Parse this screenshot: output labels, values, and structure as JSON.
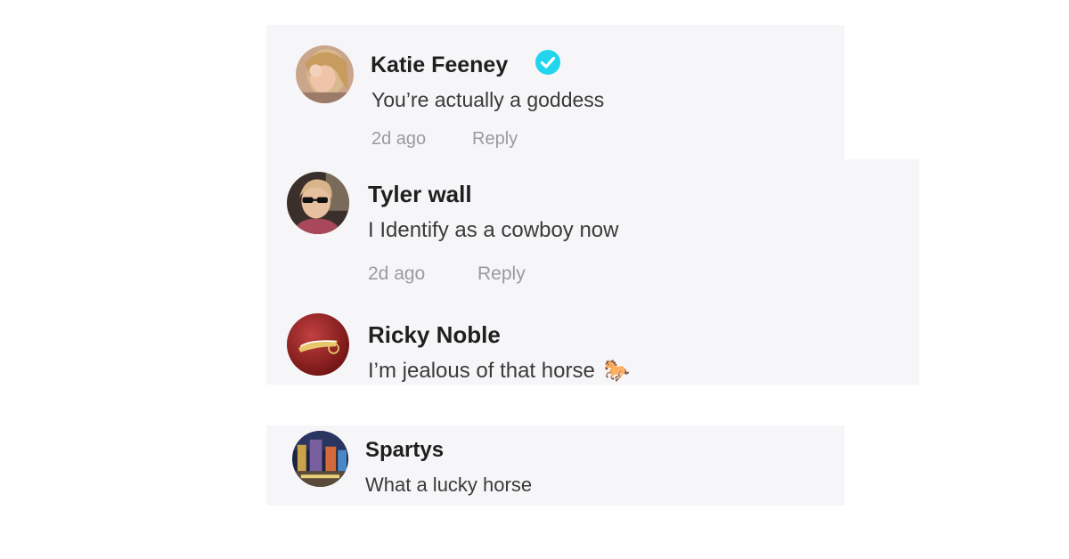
{
  "comments": [
    {
      "author": "Katie Feeney",
      "verified": true,
      "text": "You’re actually a goddess",
      "time": "2d ago",
      "reply_label": "Reply",
      "avatar_icon": "user-avatar-photo"
    },
    {
      "author": "Tyler wall",
      "verified": false,
      "text": "I Identify as a cowboy now",
      "time": "2d ago",
      "reply_label": "Reply",
      "avatar_icon": "user-avatar-photo"
    },
    {
      "author": "Ricky Noble",
      "verified": false,
      "text": "I’m jealous of that horse",
      "emoji": "🐎",
      "avatar_icon": "cavaliers-logo-avatar"
    },
    {
      "author": "Spartys",
      "verified": false,
      "text": "What a lucky horse",
      "avatar_icon": "city-night-avatar"
    }
  ],
  "colors": {
    "panel_bg": "#f6f6f8",
    "verified_badge": "#20d5ec",
    "meta_text": "#9a9a9f"
  }
}
